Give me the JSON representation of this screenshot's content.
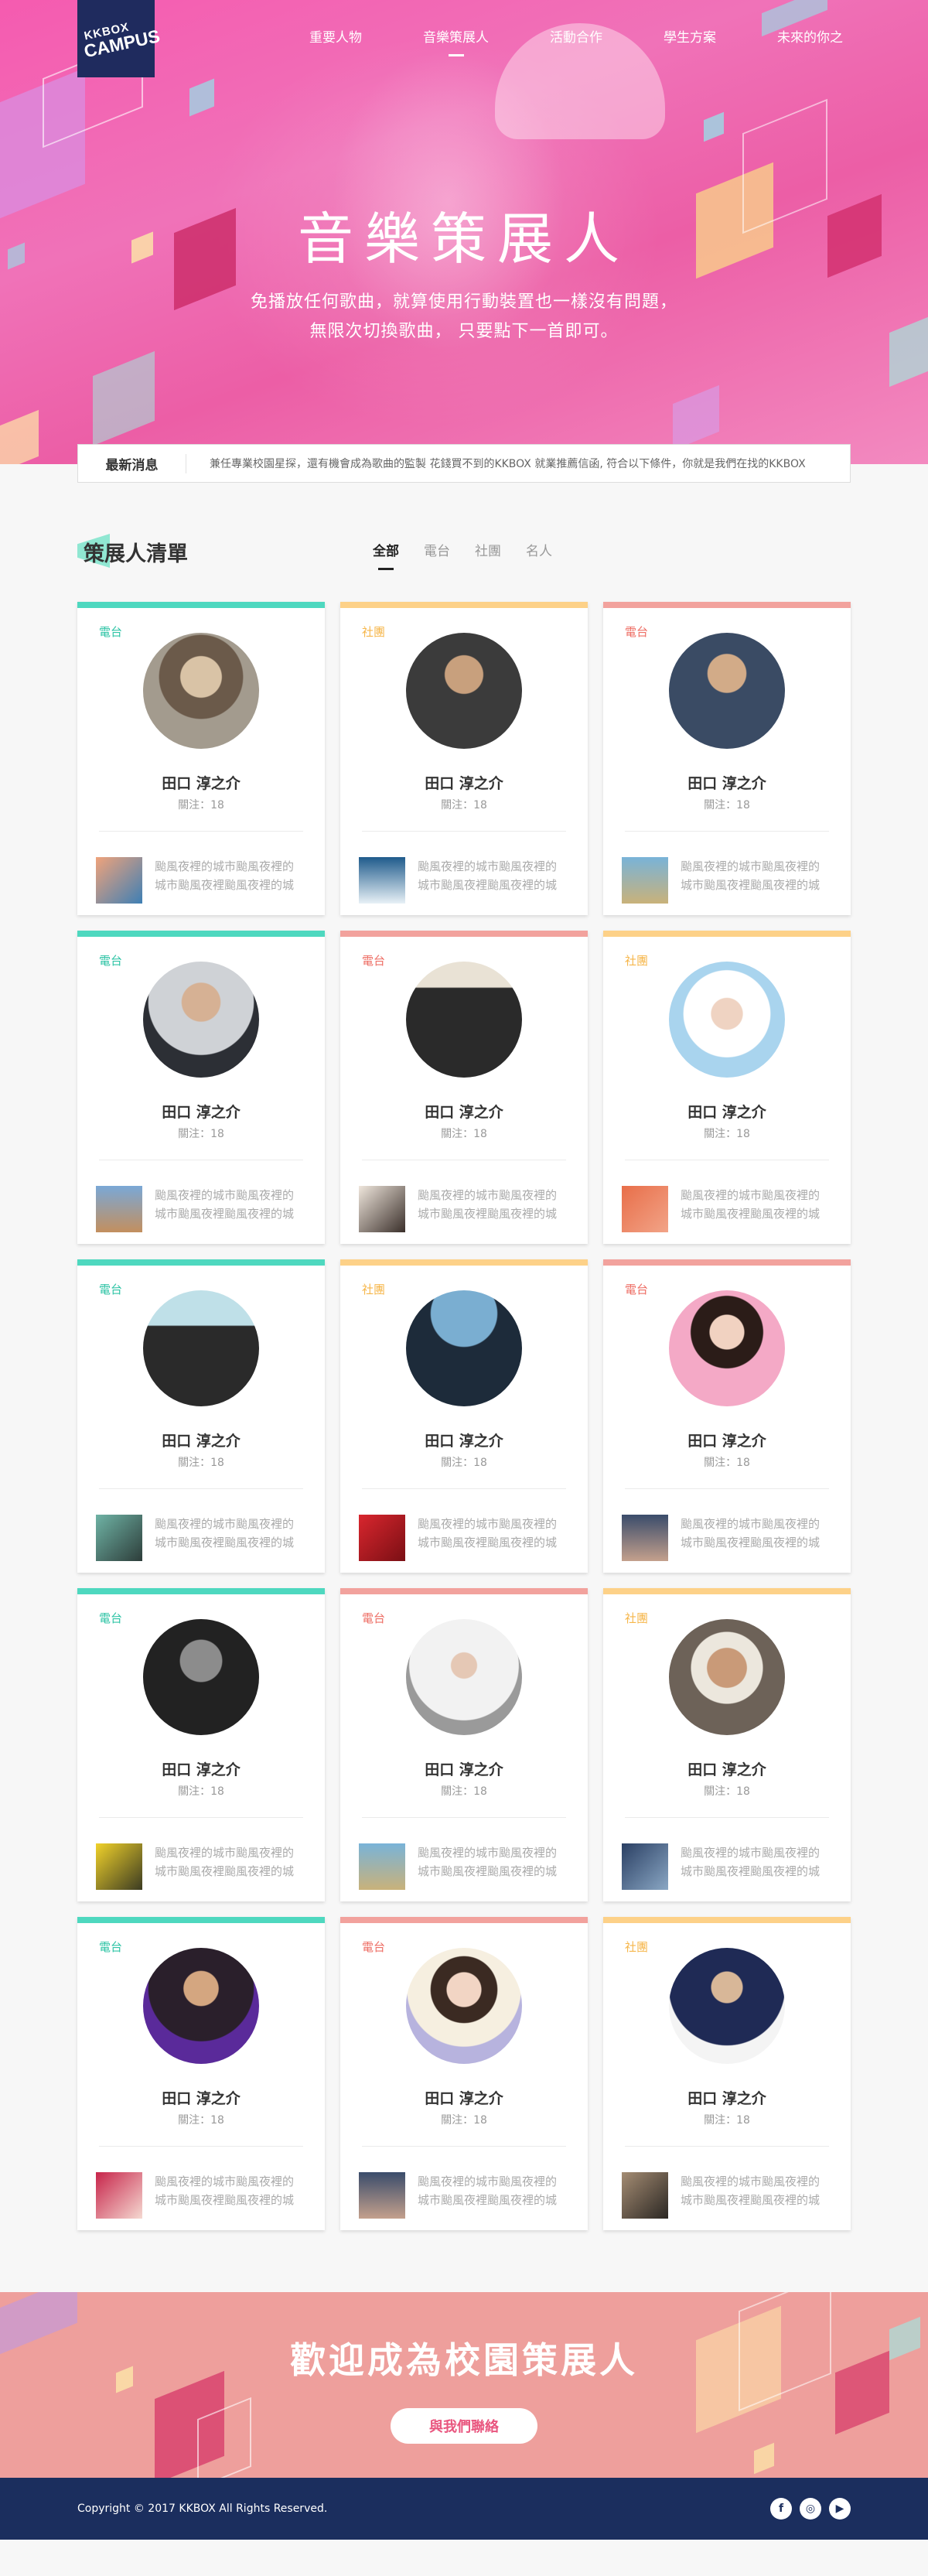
{
  "brand": {
    "line1": "KKBOX",
    "line2": "CAMPUS",
    "bg_color": "#1f2b5e"
  },
  "nav": {
    "items": [
      {
        "label": "重要人物",
        "active": false
      },
      {
        "label": "音樂策展人",
        "active": true
      },
      {
        "label": "活動合作",
        "active": false
      },
      {
        "label": "學生方案",
        "active": false
      },
      {
        "label": "未來的你之",
        "active": false
      }
    ]
  },
  "hero": {
    "title": "音樂策展人",
    "subtitle_line1": "免播放任何歌曲，就算使用行動裝置也一樣沒有問題，",
    "subtitle_line2": "無限次切換歌曲，  只要點下一首即可。",
    "accent_color": "#f062b0"
  },
  "news": {
    "tag": "最新消息",
    "message": "兼任專業校園星探，還有機會成為歌曲的監製 花錢買不到的KKBOX 就業推薦信函, 符合以下條件，你就是我們在找的KKBOX"
  },
  "list": {
    "title": "策展人清單",
    "filters": [
      {
        "label": "全部",
        "active": true
      },
      {
        "label": "電台",
        "active": false
      },
      {
        "label": "社團",
        "active": false
      },
      {
        "label": "名人",
        "active": false
      }
    ],
    "type_colors": {
      "電台_teal": "#4ed8bf",
      "社團": "#fdd188",
      "電台_red": "#f2a29d"
    },
    "cards": [
      {
        "type": "電台",
        "accent": "#4ed8bf",
        "name": "田口 淳之介",
        "follow": "關注：18",
        "desc": "颱風夜裡的城市颱風夜裡的城市颱風夜裡颱風夜裡的城",
        "avatar": "portrait-hat-woman",
        "thumb": "thumb-person"
      },
      {
        "type": "社團",
        "accent": "#fdd188",
        "name": "田口 淳之介",
        "follow": "關注：18",
        "desc": "颱風夜裡的城市颱風夜裡的城市颱風夜裡颱風夜裡的城",
        "avatar": "portrait-man-suit",
        "thumb": "thumb-wave"
      },
      {
        "type": "電台",
        "accent": "#f2a29d",
        "name": "田口 淳之介",
        "follow": "關注：18",
        "desc": "颱風夜裡的城市颱風夜裡的城市颱風夜裡颱風夜裡的城",
        "avatar": "portrait-man-jacket",
        "thumb": "thumb-field"
      },
      {
        "type": "電台",
        "accent": "#4ed8bf",
        "name": "田口 淳之介",
        "follow": "關注：18",
        "desc": "颱風夜裡的城市颱風夜裡的城市颱風夜裡颱風夜裡的城",
        "avatar": "portrait-man-blazer",
        "thumb": "thumb-sky"
      },
      {
        "type": "電台",
        "accent": "#f2a29d",
        "name": "田口 淳之介",
        "follow": "關注：18",
        "desc": "颱風夜裡的城市颱風夜裡的城市颱風夜裡颱風夜裡的城",
        "avatar": "portrait-band",
        "thumb": "thumb-man"
      },
      {
        "type": "社團",
        "accent": "#fdd188",
        "name": "田口 淳之介",
        "follow": "關注：18",
        "desc": "颱風夜裡的城市颱風夜裡的城市颱風夜裡颱風夜裡的城",
        "avatar": "portrait-snow-hood",
        "thumb": "thumb-orange"
      },
      {
        "type": "電台",
        "accent": "#4ed8bf",
        "name": "田口 淳之介",
        "follow": "關注：18",
        "desc": "颱風夜裡的城市颱風夜裡的城市颱風夜裡颱風夜裡的城",
        "avatar": "portrait-duo",
        "thumb": "thumb-face"
      },
      {
        "type": "社團",
        "accent": "#fdd188",
        "name": "田口 淳之介",
        "follow": "關注：18",
        "desc": "颱風夜裡的城市颱風夜裡的城市颱風夜裡颱風夜裡的城",
        "avatar": "portrait-group",
        "thumb": "thumb-red"
      },
      {
        "type": "電台",
        "accent": "#f2a29d",
        "name": "田口 淳之介",
        "follow": "關注：18",
        "desc": "颱風夜裡的城市颱風夜裡的城市颱風夜裡颱風夜裡的城",
        "avatar": "portrait-woman-pink",
        "thumb": "thumb-mountain"
      },
      {
        "type": "電台",
        "accent": "#4ed8bf",
        "name": "田口 淳之介",
        "follow": "關注：18",
        "desc": "颱風夜裡的城市颱風夜裡的城市颱風夜裡颱風夜裡的城",
        "avatar": "portrait-bw-man",
        "thumb": "thumb-yellow"
      },
      {
        "type": "電台",
        "accent": "#f2a29d",
        "name": "田口 淳之介",
        "follow": "關注：18",
        "desc": "颱風夜裡的城市颱風夜裡的城市颱風夜裡颱風夜裡的城",
        "avatar": "portrait-hoodie",
        "thumb": "thumb-field"
      },
      {
        "type": "社團",
        "accent": "#fdd188",
        "name": "田口 淳之介",
        "follow": "關注：18",
        "desc": "颱風夜裡的城市颱風夜裡的城市颱風夜裡颱風夜裡的城",
        "avatar": "portrait-man-cap",
        "thumb": "thumb-blue"
      },
      {
        "type": "電台",
        "accent": "#4ed8bf",
        "name": "田口 淳之介",
        "follow": "關注：18",
        "desc": "颱風夜裡的城市颱風夜裡的城市颱風夜裡颱風夜裡的城",
        "avatar": "portrait-purple-man",
        "thumb": "thumb-mask"
      },
      {
        "type": "電台",
        "accent": "#f2a29d",
        "name": "田口 淳之介",
        "follow": "關注：18",
        "desc": "颱風夜裡的城市颱風夜裡的城市颱風夜裡颱風夜裡的城",
        "avatar": "portrait-lilac-woman",
        "thumb": "thumb-mountain"
      },
      {
        "type": "社團",
        "accent": "#fdd188",
        "name": "田口 淳之介",
        "follow": "關注：18",
        "desc": "颱風夜裡的城市颱風夜裡的城市颱風夜裡颱風夜裡的城",
        "avatar": "portrait-leaf-man",
        "thumb": "thumb-old-man"
      }
    ]
  },
  "cta": {
    "title": "歡迎成為校園策展人",
    "button_label": "與我們聯絡",
    "bg_color": "#ee9f9c",
    "button_text_color": "#e9567f"
  },
  "footer": {
    "copyright": "Copyright © 2017 KKBOX All Rights Reserved.",
    "socials": [
      {
        "name": "facebook-icon",
        "glyph": "f"
      },
      {
        "name": "instagram-icon",
        "glyph": "◎"
      },
      {
        "name": "youtube-icon",
        "glyph": "▶"
      }
    ],
    "bg_color": "#1b2e5e"
  }
}
